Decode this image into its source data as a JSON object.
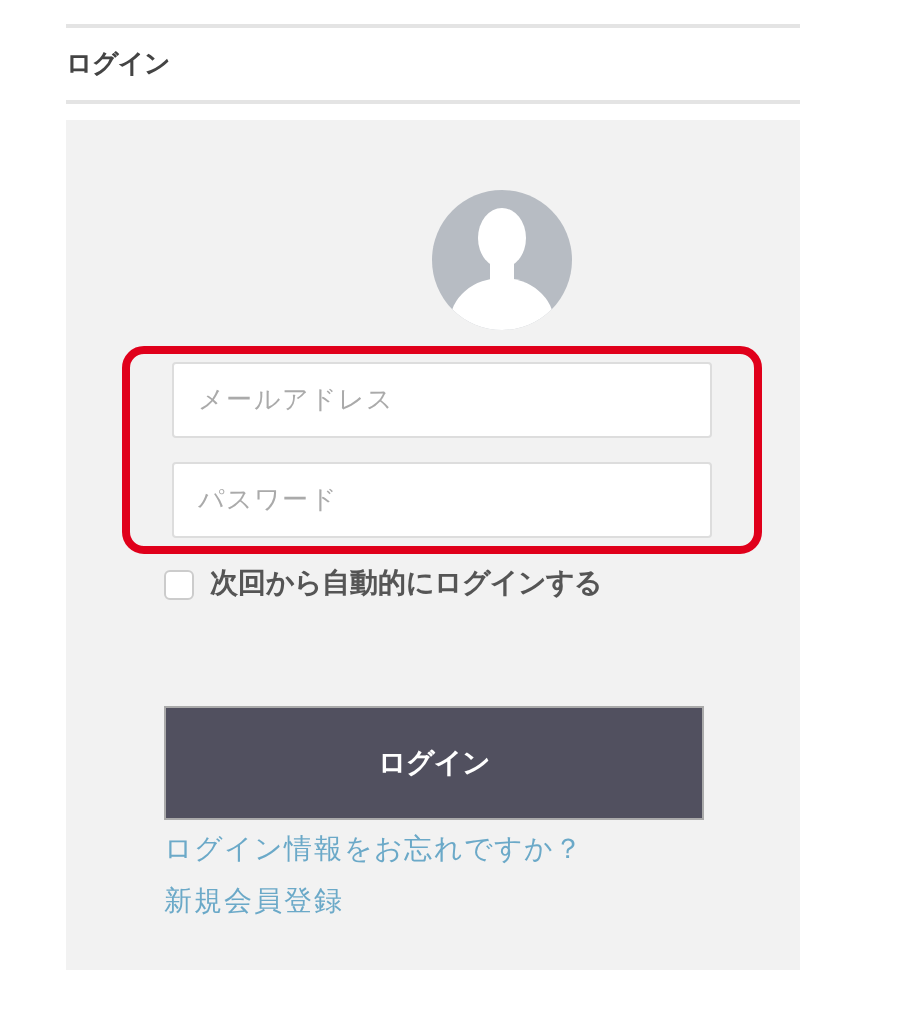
{
  "heading": "ログイン",
  "form": {
    "credentials_highlighted": true,
    "email": {
      "placeholder": "メールアドレス"
    },
    "password": {
      "placeholder": "パスワード"
    },
    "remember": {
      "label": "次回から自動的にログインする",
      "checked": false
    },
    "submit": "ログイン",
    "links": [
      "ログイン情報をお忘れですか？",
      "新規会員登録"
    ]
  }
}
